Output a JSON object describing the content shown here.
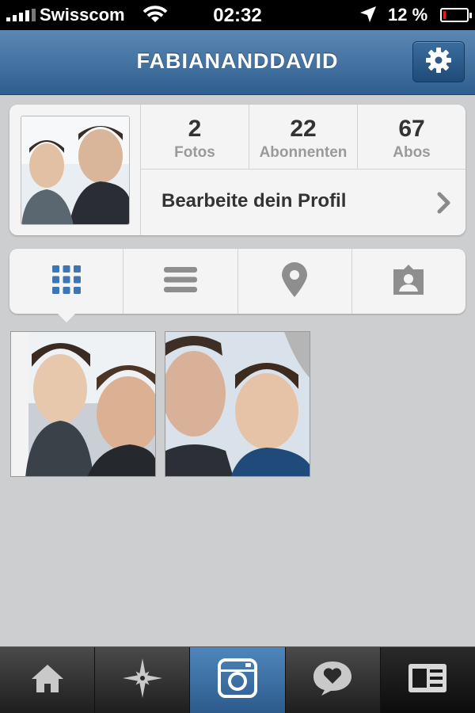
{
  "status_bar": {
    "carrier": "Swisscom",
    "time": "02:32",
    "battery_percent_text": "12 %",
    "battery_level": 0.12,
    "battery_color": "#e02020"
  },
  "navbar": {
    "title": "FABIANANDDAVID",
    "settings_icon": "gear-icon",
    "background": "#3b6d9d"
  },
  "profile": {
    "stats": [
      {
        "value": "2",
        "label": "Fotos"
      },
      {
        "value": "22",
        "label": "Abonnenten"
      },
      {
        "value": "67",
        "label": "Abos"
      }
    ],
    "edit_label": "Bearbeite dein Profil"
  },
  "view_tabs": [
    {
      "icon": "grid-icon",
      "active": true
    },
    {
      "icon": "list-icon",
      "active": false
    },
    {
      "icon": "location-pin-icon",
      "active": false
    },
    {
      "icon": "tagged-person-icon",
      "active": false
    }
  ],
  "photos": [
    {
      "icon": "photo-thumbnail"
    },
    {
      "icon": "photo-thumbnail"
    }
  ],
  "tab_bar": [
    {
      "icon": "home-icon",
      "active": false
    },
    {
      "icon": "explore-star-icon",
      "active": false
    },
    {
      "icon": "camera-icon",
      "active": true
    },
    {
      "icon": "speech-heart-icon",
      "active": false
    },
    {
      "icon": "profile-card-icon",
      "active": false
    }
  ]
}
